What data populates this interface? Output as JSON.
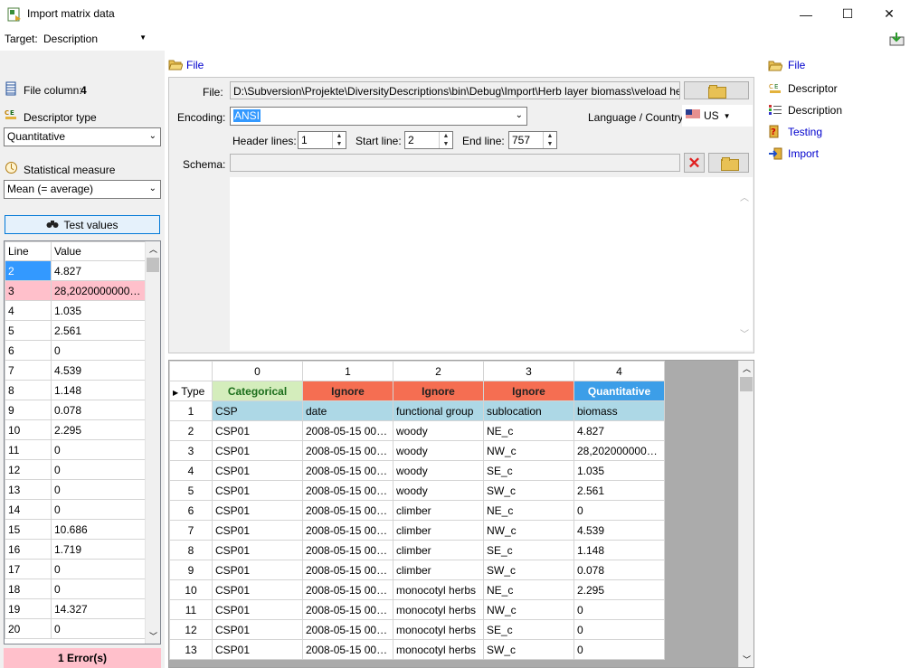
{
  "window": {
    "title": "Import matrix data",
    "minimize": "—",
    "maximize": "☐",
    "close": "✕"
  },
  "target": {
    "label": "Target:",
    "value": "Description"
  },
  "left": {
    "file_column_label": "File column:",
    "file_column_value": "4",
    "descriptor_type_label": "Descriptor type",
    "descriptor_type_value": "Quantitative",
    "stat_measure_label": "Statistical measure",
    "stat_measure_value": "Mean (= average)",
    "test_values_label": "Test values",
    "columns": [
      "Line",
      "Value"
    ],
    "rows": [
      {
        "line": "2",
        "value": "4.827"
      },
      {
        "line": "3",
        "value": "28,202000000000..."
      },
      {
        "line": "4",
        "value": "1.035"
      },
      {
        "line": "5",
        "value": "2.561"
      },
      {
        "line": "6",
        "value": "0"
      },
      {
        "line": "7",
        "value": "4.539"
      },
      {
        "line": "8",
        "value": "1.148"
      },
      {
        "line": "9",
        "value": "0.078"
      },
      {
        "line": "10",
        "value": "2.295"
      },
      {
        "line": "11",
        "value": "0"
      },
      {
        "line": "12",
        "value": "0"
      },
      {
        "line": "13",
        "value": "0"
      },
      {
        "line": "14",
        "value": "0"
      },
      {
        "line": "15",
        "value": "10.686"
      },
      {
        "line": "16",
        "value": "1.719"
      },
      {
        "line": "17",
        "value": "0"
      },
      {
        "line": "18",
        "value": "0"
      },
      {
        "line": "19",
        "value": "14.327"
      },
      {
        "line": "20",
        "value": "0"
      }
    ],
    "errors": "1 Error(s)"
  },
  "file_panel": {
    "header": "File",
    "file_label": "File:",
    "file_path": "D:\\Subversion\\Projekte\\DiversityDescriptions\\bin\\Debug\\Import\\Herb layer biomass\\veload herb layer b",
    "encoding_label": "Encoding:",
    "encoding_value": "ANSI",
    "language_label": "Language / Country:",
    "language_value": "US",
    "header_lines_label": "Header lines:",
    "header_lines_value": "1",
    "start_line_label": "Start line:",
    "start_line_value": "2",
    "end_line_label": "End line:",
    "end_line_value": "757",
    "schema_label": "Schema:",
    "schema_value": ""
  },
  "grid": {
    "col_numbers": [
      "0",
      "1",
      "2",
      "3",
      "4"
    ],
    "type_label": "Type",
    "types": [
      "Categorical",
      "Ignore",
      "Ignore",
      "Ignore",
      "Quantitative"
    ],
    "header_row": {
      "num": "1",
      "cells": [
        "CSP",
        "date",
        "functional group",
        "sublocation",
        "biomass"
      ]
    },
    "rows": [
      {
        "num": "2",
        "cells": [
          "CSP01",
          "2008-05-15 00:0...",
          "woody",
          "NE_c",
          "4.827"
        ]
      },
      {
        "num": "3",
        "cells": [
          "CSP01",
          "2008-05-15 00:0...",
          "woody",
          "NW_c",
          "28,20200000000..."
        ]
      },
      {
        "num": "4",
        "cells": [
          "CSP01",
          "2008-05-15 00:0...",
          "woody",
          "SE_c",
          "1.035"
        ]
      },
      {
        "num": "5",
        "cells": [
          "CSP01",
          "2008-05-15 00:0...",
          "woody",
          "SW_c",
          "2.561"
        ]
      },
      {
        "num": "6",
        "cells": [
          "CSP01",
          "2008-05-15 00:0...",
          "climber",
          "NE_c",
          "0"
        ]
      },
      {
        "num": "7",
        "cells": [
          "CSP01",
          "2008-05-15 00:0...",
          "climber",
          "NW_c",
          "4.539"
        ]
      },
      {
        "num": "8",
        "cells": [
          "CSP01",
          "2008-05-15 00:0...",
          "climber",
          "SE_c",
          "1.148"
        ]
      },
      {
        "num": "9",
        "cells": [
          "CSP01",
          "2008-05-15 00:0...",
          "climber",
          "SW_c",
          "0.078"
        ]
      },
      {
        "num": "10",
        "cells": [
          "CSP01",
          "2008-05-15 00:0...",
          "monocotyl herbs",
          "NE_c",
          "2.295"
        ]
      },
      {
        "num": "11",
        "cells": [
          "CSP01",
          "2008-05-15 00:0...",
          "monocotyl herbs",
          "NW_c",
          "0"
        ]
      },
      {
        "num": "12",
        "cells": [
          "CSP01",
          "2008-05-15 00:0...",
          "monocotyl herbs",
          "SE_c",
          "0"
        ]
      },
      {
        "num": "13",
        "cells": [
          "CSP01",
          "2008-05-15 00:0...",
          "monocotyl herbs",
          "SW_c",
          "0"
        ]
      }
    ]
  },
  "nav": {
    "items": [
      {
        "label": "File",
        "icon": "folder-icon",
        "link": true
      },
      {
        "label": "Descriptor",
        "icon": "descriptor-icon",
        "link": false
      },
      {
        "label": "Description",
        "icon": "description-icon",
        "link": false
      },
      {
        "label": "Testing",
        "icon": "testing-icon",
        "link": true
      },
      {
        "label": "Import",
        "icon": "import-icon",
        "link": true
      }
    ]
  },
  "colors": {
    "categorical_bg": "#d4edbc",
    "ignore_bg": "#f56e52",
    "quantitative_bg": "#3c9ee8",
    "header_row_bg": "#add8e6",
    "selected_bg": "#3399ff",
    "error_bg": "#ffc0cb"
  }
}
